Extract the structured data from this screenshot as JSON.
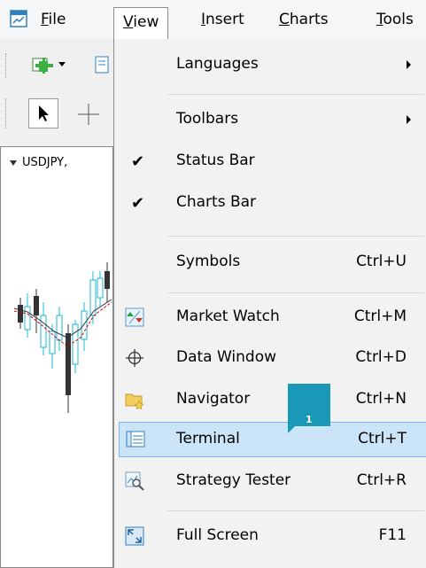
{
  "menubar": {
    "items": [
      {
        "label": "File",
        "mnemonic": "F"
      },
      {
        "label": "View",
        "mnemonic": "V"
      },
      {
        "label": "Insert",
        "mnemonic": "I"
      },
      {
        "label": "Charts",
        "mnemonic": "C"
      },
      {
        "label": "Tools",
        "mnemonic": "T"
      }
    ],
    "active": "View"
  },
  "chart": {
    "tab_label": "USDJPY,"
  },
  "view_menu": {
    "items": [
      {
        "label": "Languages",
        "submenu": true
      },
      {
        "label": "Toolbars",
        "submenu": true
      },
      {
        "label": "Status Bar",
        "checked": true
      },
      {
        "label": "Charts Bar",
        "checked": true
      },
      {
        "label": "Symbols",
        "shortcut": "Ctrl+U"
      },
      {
        "label": "Market Watch",
        "shortcut": "Ctrl+M",
        "icon": "market-watch-icon"
      },
      {
        "label": "Data Window",
        "shortcut": "Ctrl+D",
        "icon": "crosshair-icon"
      },
      {
        "label": "Navigator",
        "shortcut": "Ctrl+N",
        "icon": "navigator-folder-icon"
      },
      {
        "label": "Terminal",
        "shortcut": "Ctrl+T",
        "icon": "terminal-icon",
        "highlighted": true
      },
      {
        "label": "Strategy Tester",
        "shortcut": "Ctrl+R",
        "icon": "strategy-tester-icon"
      },
      {
        "label": "Full Screen",
        "shortcut": "F11",
        "icon": "full-screen-icon"
      }
    ],
    "check_glyph": "✔"
  },
  "annotation": {
    "badge_number": "1"
  },
  "colors": {
    "highlight": "#cce4f7",
    "badge": "#1a98b8",
    "bull_candle": "#1ab8d8",
    "bear_candle": "#333333",
    "ma_line": "#cc0000"
  }
}
